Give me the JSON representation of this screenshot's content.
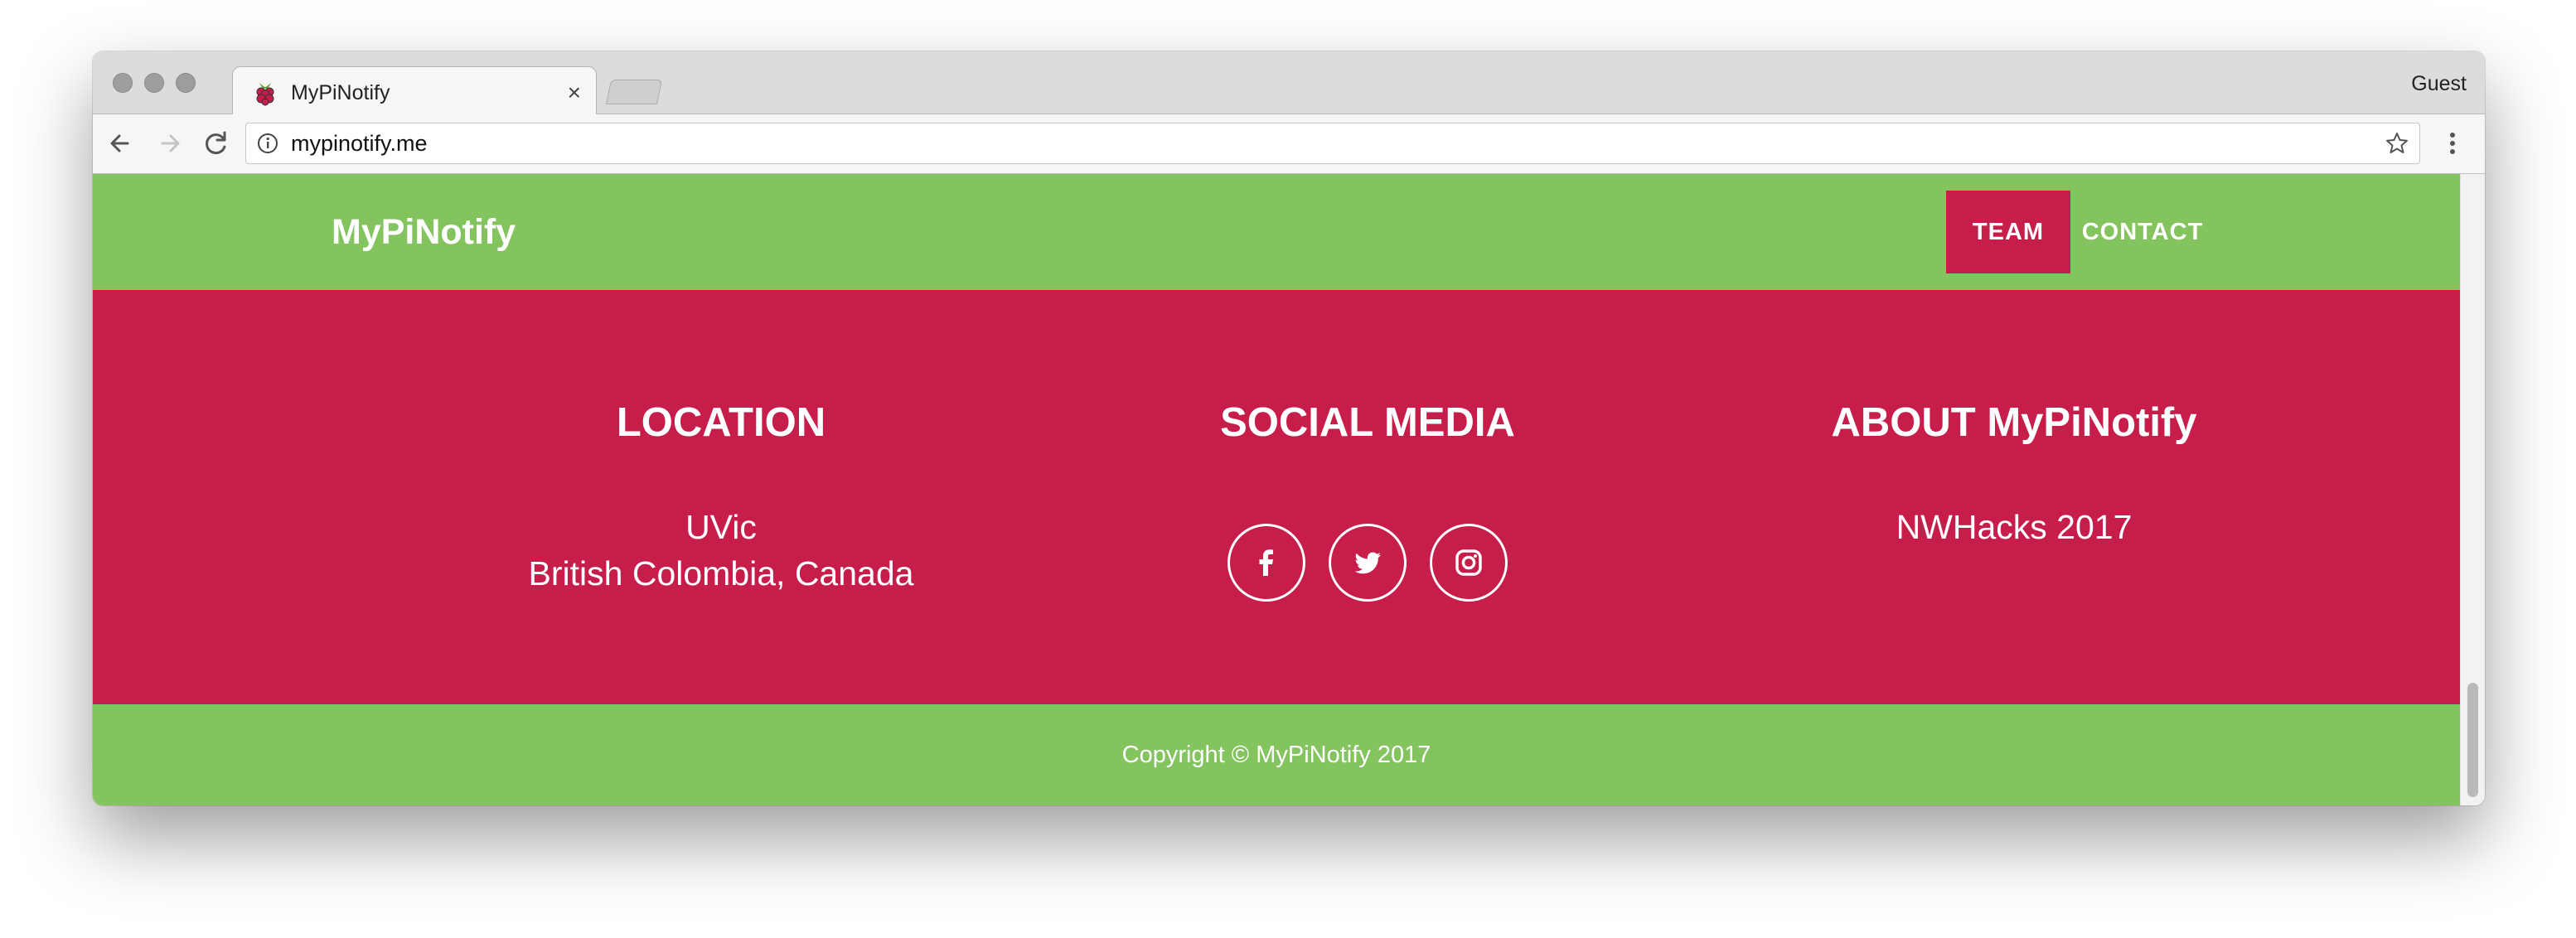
{
  "browser": {
    "tab_title": "MyPiNotify",
    "tab_close": "×",
    "profile_label": "Guest",
    "url": "mypinotify.me"
  },
  "navbar": {
    "brand": "MyPiNotify",
    "links": [
      {
        "label": "TEAM",
        "active": true
      },
      {
        "label": "CONTACT",
        "active": false
      }
    ]
  },
  "footer": {
    "location": {
      "heading": "LOCATION",
      "line1": "UVic",
      "line2": "British Colombia, Canada"
    },
    "social": {
      "heading": "SOCIAL MEDIA",
      "icons": [
        "facebook-icon",
        "twitter-icon",
        "instagram-icon"
      ]
    },
    "about": {
      "heading": "ABOUT MyPiNotify",
      "text": "NWHacks 2017"
    },
    "copyright": "Copyright © MyPiNotify 2017"
  },
  "colors": {
    "green": "#84c45f",
    "crimson": "#c71d4a",
    "white": "#ffffff"
  }
}
